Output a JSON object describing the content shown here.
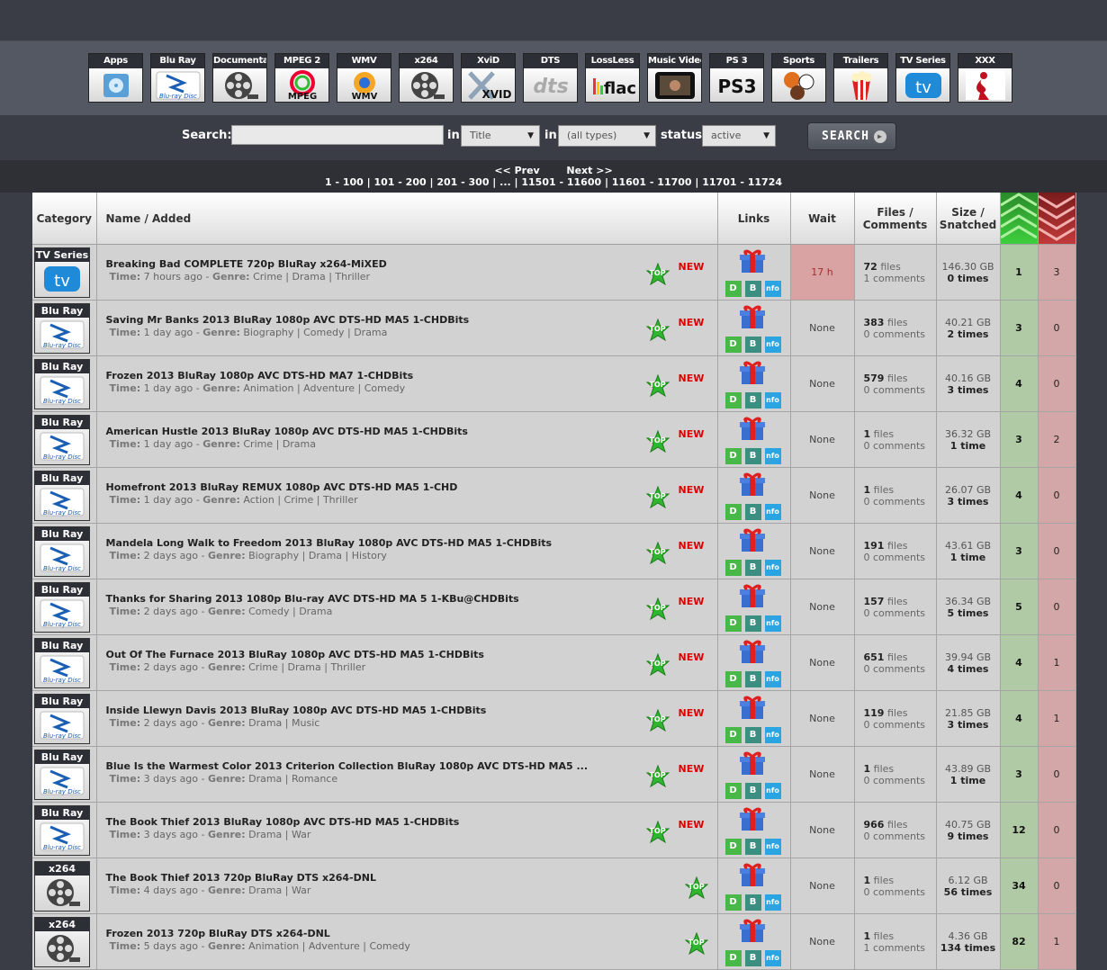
{
  "categories": [
    {
      "label": "Apps",
      "icon": "apps-icon"
    },
    {
      "label": "Blu Ray",
      "icon": "bluray-icon"
    },
    {
      "label": "Documentary",
      "icon": "film-reel-icon"
    },
    {
      "label": "MPEG 2",
      "icon": "mpeg-icon"
    },
    {
      "label": "WMV",
      "icon": "wmv-icon"
    },
    {
      "label": "x264",
      "icon": "film-reel-icon"
    },
    {
      "label": "XviD",
      "icon": "xvid-icon"
    },
    {
      "label": "DTS",
      "icon": "dts-icon"
    },
    {
      "label": "LossLess",
      "icon": "flac-icon"
    },
    {
      "label": "Music Videos",
      "icon": "music-video-icon"
    },
    {
      "label": "PS 3",
      "icon": "ps3-icon"
    },
    {
      "label": "Sports",
      "icon": "sports-balls-icon"
    },
    {
      "label": "Trailers",
      "icon": "popcorn-icon"
    },
    {
      "label": "TV Series",
      "icon": "tv-icon"
    },
    {
      "label": "XXX",
      "icon": "silhouette-icon"
    }
  ],
  "search": {
    "label": "Search:",
    "value": "",
    "in1": "in",
    "field": "Title",
    "in2": "in",
    "type": "(all types)",
    "status_label": "status",
    "status": "active",
    "button": "SEARCH"
  },
  "pager": {
    "prev": "<< Prev",
    "next": "Next >>",
    "pages": "1 - 100 | 101 - 200 | 201 - 300 | ... | 11501 - 11600 | 11601 - 11700 | 11701 - 11724"
  },
  "columns": {
    "category": "Category",
    "name": "Name / Added",
    "links": "Links",
    "wait": "Wait",
    "files1": "Files /",
    "files2": "Comments",
    "size1": "Size /",
    "size2": "Snatched"
  },
  "labels": {
    "time": "Time:",
    "genre": "Genre:",
    "files": "files",
    "comments": "comments",
    "top": "TOP",
    "new": "NEW",
    "d": "D",
    "b": "B",
    "info": "nfo"
  },
  "rows": [
    {
      "cat": "TV Series",
      "title": "Breaking Bad COMPLETE 720p BluRay x264-MiXED",
      "time": "7 hours ago",
      "genre": "Crime | Drama | Thriller",
      "new": true,
      "wait": "17 h",
      "files": "72",
      "comments": "1",
      "size": "146.30 GB",
      "snatched": "0 times",
      "seeders": "1",
      "leechers": "3"
    },
    {
      "cat": "Blu Ray",
      "title": "Saving Mr Banks 2013 BluRay 1080p AVC DTS-HD MA5 1-CHDBits",
      "time": "1 day ago",
      "genre": "Biography | Comedy | Drama",
      "new": true,
      "wait": "None",
      "files": "383",
      "comments": "0",
      "size": "40.21 GB",
      "snatched": "2 times",
      "seeders": "3",
      "leechers": "0"
    },
    {
      "cat": "Blu Ray",
      "title": "Frozen 2013 BluRay 1080p AVC DTS-HD MA7 1-CHDBits",
      "time": "1 day ago",
      "genre": "Animation | Adventure | Comedy",
      "new": true,
      "wait": "None",
      "files": "579",
      "comments": "0",
      "size": "40.16 GB",
      "snatched": "3 times",
      "seeders": "4",
      "leechers": "0"
    },
    {
      "cat": "Blu Ray",
      "title": "American Hustle 2013 BluRay 1080p AVC DTS-HD MA5 1-CHDBits",
      "time": "1 day ago",
      "genre": "Crime | Drama",
      "new": true,
      "wait": "None",
      "files": "1",
      "comments": "0",
      "size": "36.32 GB",
      "snatched": "1 time",
      "seeders": "3",
      "leechers": "2"
    },
    {
      "cat": "Blu Ray",
      "title": "Homefront 2013 BluRay REMUX 1080p AVC DTS-HD MA5 1-CHD",
      "time": "1 day ago",
      "genre": "Action | Crime | Thriller",
      "new": true,
      "wait": "None",
      "files": "1",
      "comments": "0",
      "size": "26.07 GB",
      "snatched": "3 times",
      "seeders": "4",
      "leechers": "0"
    },
    {
      "cat": "Blu Ray",
      "title": "Mandela Long Walk to Freedom 2013 BluRay 1080p AVC DTS-HD MA5 1-CHDBits",
      "time": "2 days ago",
      "genre": "Biography | Drama | History",
      "new": true,
      "wait": "None",
      "files": "191",
      "comments": "0",
      "size": "43.61 GB",
      "snatched": "1 time",
      "seeders": "3",
      "leechers": "0"
    },
    {
      "cat": "Blu Ray",
      "title": "Thanks for Sharing 2013 1080p Blu-ray AVC DTS-HD MA 5 1-KBu@CHDBits",
      "time": "2 days ago",
      "genre": "Comedy | Drama",
      "new": true,
      "wait": "None",
      "files": "157",
      "comments": "0",
      "size": "36.34 GB",
      "snatched": "5 times",
      "seeders": "5",
      "leechers": "0"
    },
    {
      "cat": "Blu Ray",
      "title": "Out Of The Furnace 2013 BluRay 1080p AVC DTS-HD MA5 1-CHDBits",
      "time": "2 days ago",
      "genre": "Crime | Drama | Thriller",
      "new": true,
      "wait": "None",
      "files": "651",
      "comments": "0",
      "size": "39.94 GB",
      "snatched": "4 times",
      "seeders": "4",
      "leechers": "1"
    },
    {
      "cat": "Blu Ray",
      "title": "Inside Llewyn Davis 2013 BluRay 1080p AVC DTS-HD MA5 1-CHDBits",
      "time": "2 days ago",
      "genre": "Drama | Music",
      "new": true,
      "wait": "None",
      "files": "119",
      "comments": "0",
      "size": "21.85 GB",
      "snatched": "3 times",
      "seeders": "4",
      "leechers": "1"
    },
    {
      "cat": "Blu Ray",
      "title": "Blue Is the Warmest Color 2013 Criterion Collection BluRay 1080p AVC DTS-HD MA5 ...",
      "time": "3 days ago",
      "genre": "Drama | Romance",
      "new": true,
      "wait": "None",
      "files": "1",
      "comments": "0",
      "size": "43.89 GB",
      "snatched": "1 time",
      "seeders": "3",
      "leechers": "0"
    },
    {
      "cat": "Blu Ray",
      "title": "The Book Thief 2013 BluRay 1080p AVC DTS-HD MA5 1-CHDBits",
      "time": "3 days ago",
      "genre": "Drama | War",
      "new": true,
      "wait": "None",
      "files": "966",
      "comments": "0",
      "size": "40.75 GB",
      "snatched": "9 times",
      "seeders": "12",
      "leechers": "0"
    },
    {
      "cat": "x264",
      "title": "The Book Thief 2013 720p BluRay DTS x264-DNL",
      "time": "4 days ago",
      "genre": "Drama | War",
      "new": false,
      "wait": "None",
      "files": "1",
      "comments": "0",
      "size": "6.12 GB",
      "snatched": "56 times",
      "seeders": "34",
      "leechers": "0"
    },
    {
      "cat": "x264",
      "title": "Frozen 2013 720p BluRay DTS x264-DNL",
      "time": "5 days ago",
      "genre": "Animation | Adventure | Comedy",
      "new": false,
      "wait": "None",
      "files": "1",
      "comments": "1",
      "size": "4.36 GB",
      "snatched": "134 times",
      "seeders": "82",
      "leechers": "1"
    }
  ]
}
